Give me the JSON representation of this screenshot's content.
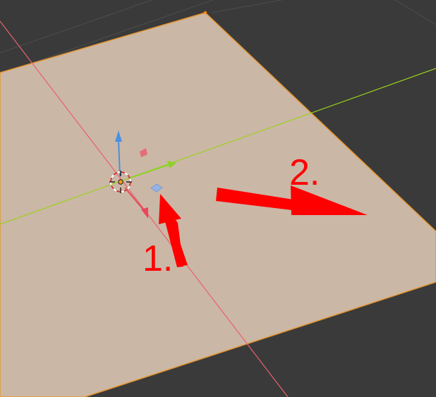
{
  "viewport": {
    "background": "#3a3a3a",
    "grid_color": "#4d4d4d",
    "plane_fill": "#cbb7a6",
    "plane_outline": "#e5952e",
    "x_axis_color": "#e8616c",
    "y_axis_color": "#9bd11c"
  },
  "gizmo": {
    "x_color": "#e8485a",
    "y_color": "#8ed227",
    "z_color": "#4a90e2",
    "plane_handle_xz_color": "#e8616c",
    "plane_handle_xy_color": "#8fb4ec",
    "icons": [
      "transform-gizmo-icon",
      "object-origin-icon",
      "3d-cursor-icon"
    ]
  },
  "annotations": [
    {
      "label": "1.",
      "color": "#ff0000"
    },
    {
      "label": "2.",
      "color": "#ff0000"
    }
  ]
}
